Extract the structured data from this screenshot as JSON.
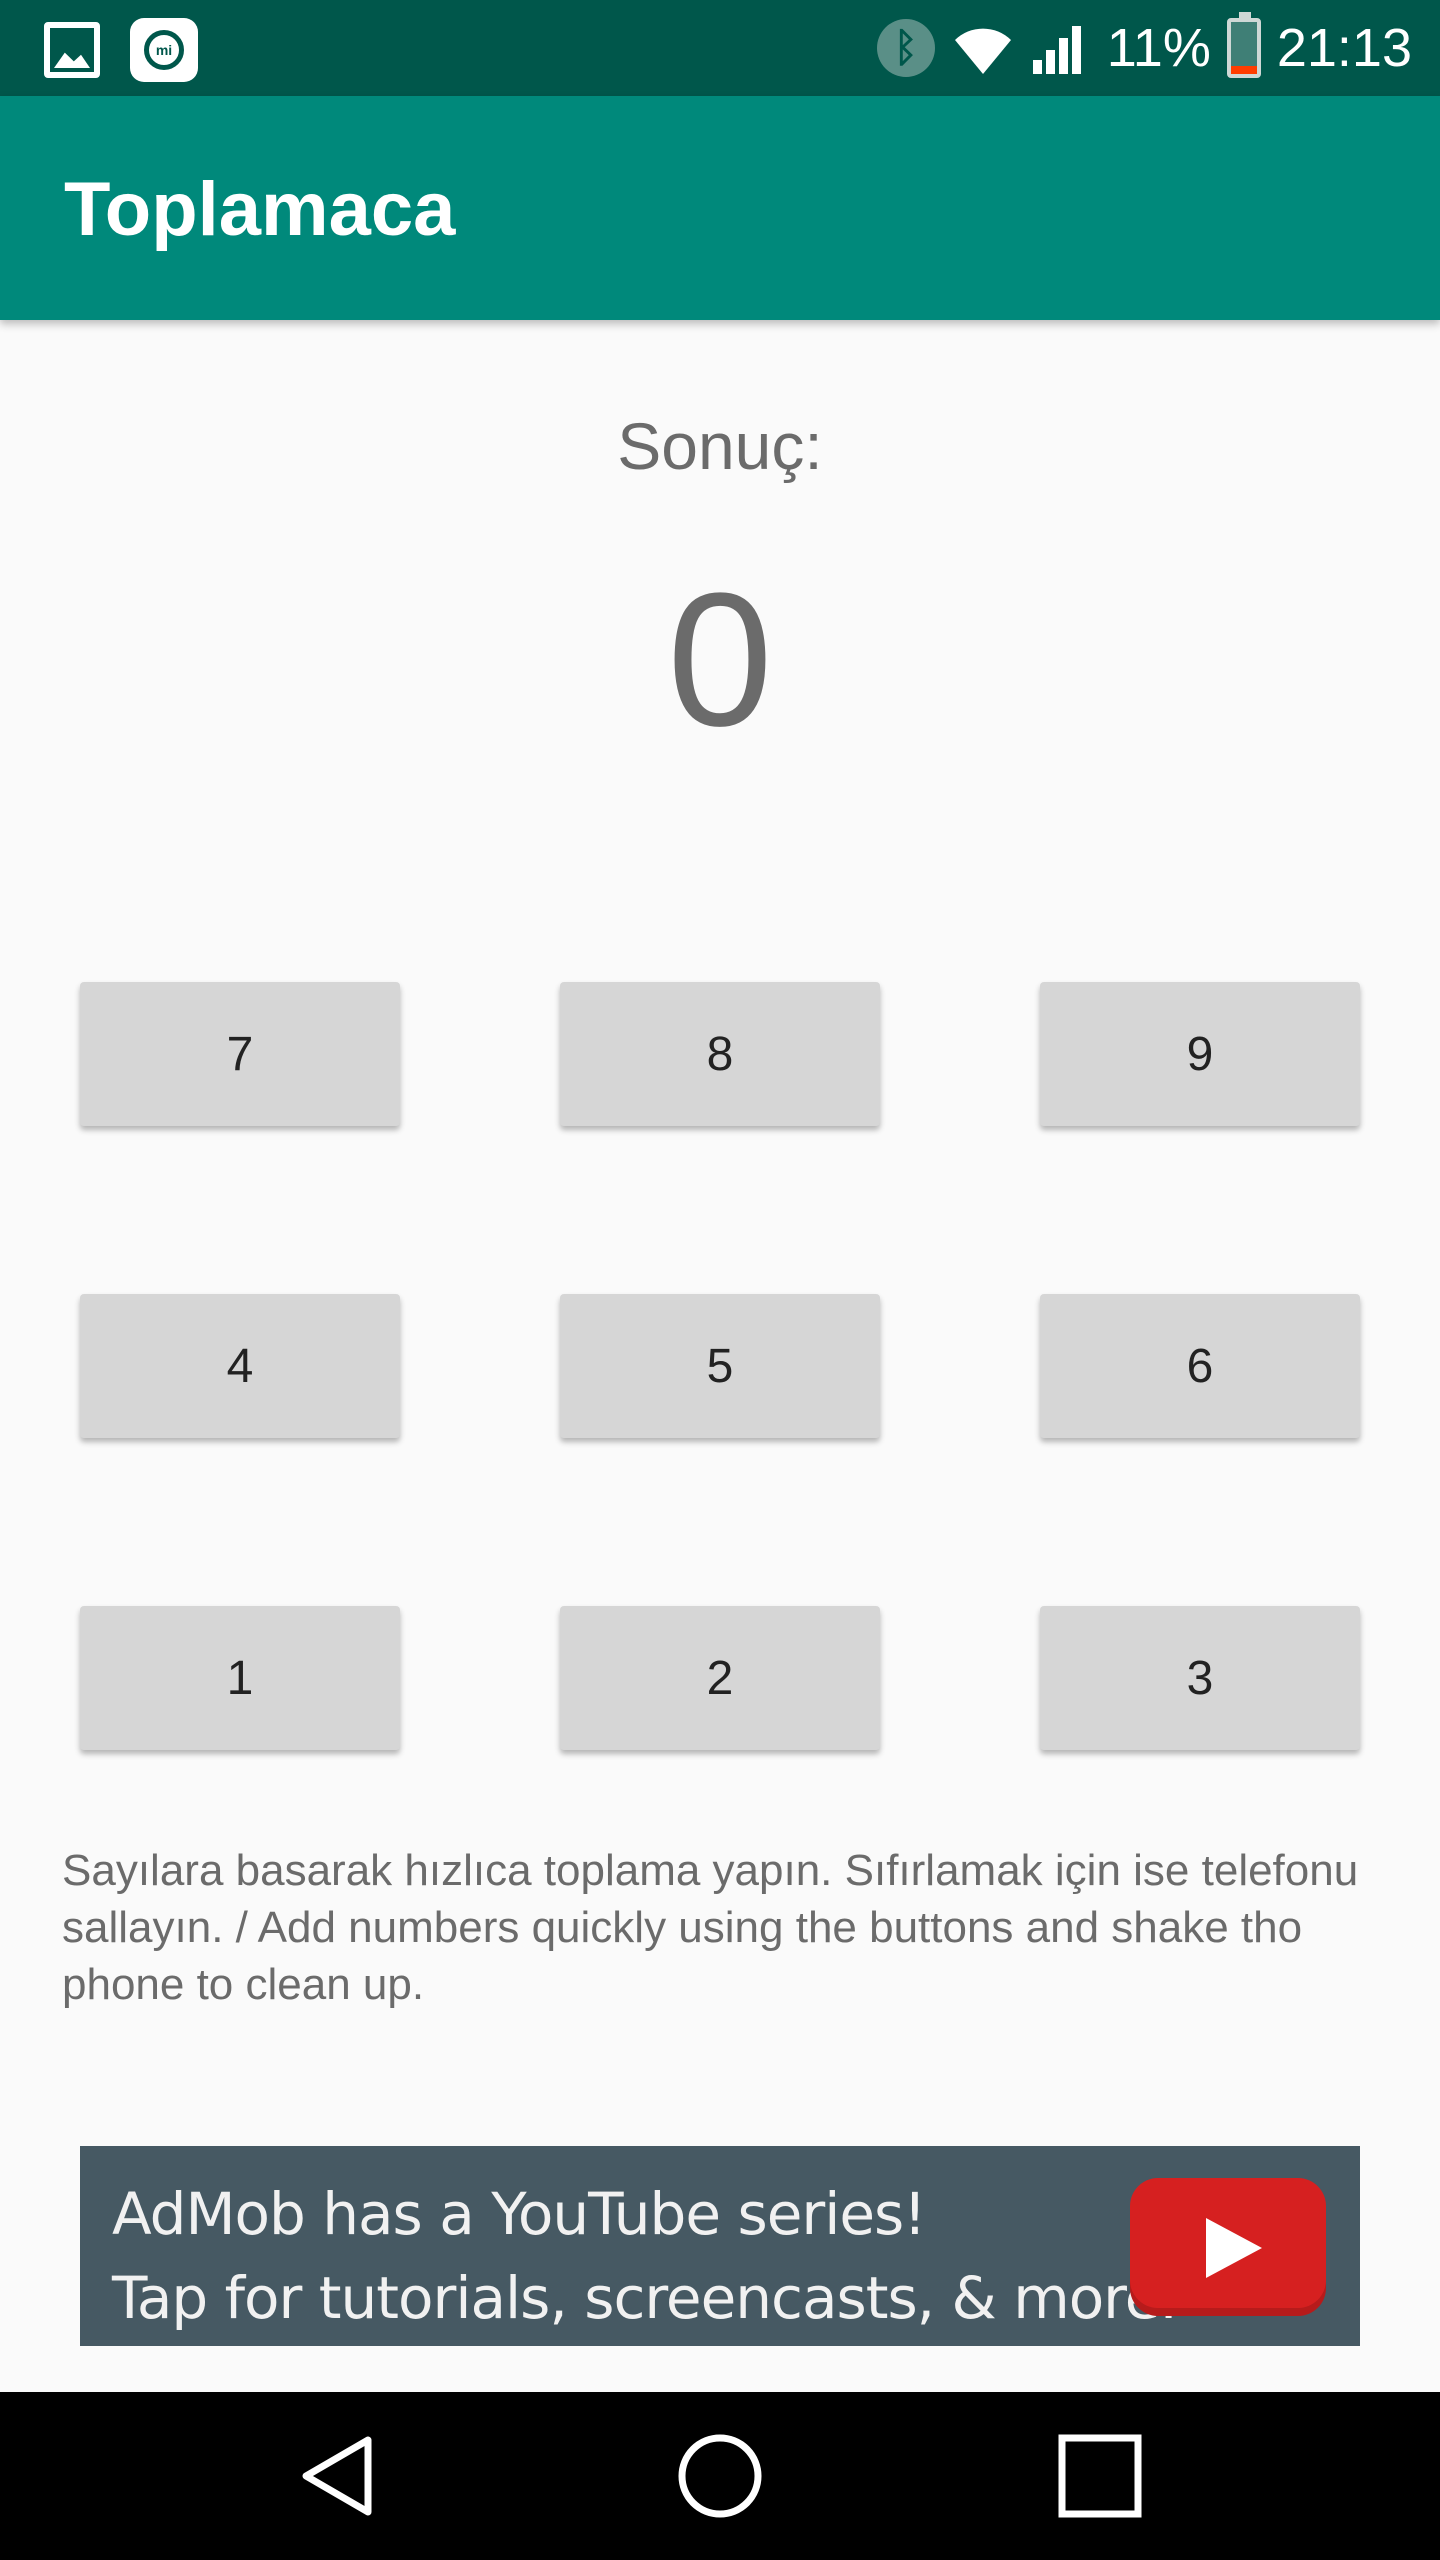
{
  "status_bar": {
    "battery": "11%",
    "time": "21:13",
    "icons": [
      "gallery-icon",
      "mi-icon",
      "bluetooth-icon",
      "wifi-icon",
      "signal-icon",
      "battery-icon"
    ]
  },
  "app_bar": {
    "title": "Toplamaca",
    "color": "#00897b"
  },
  "result": {
    "label": "Sonuç:",
    "value": "0"
  },
  "keypad": {
    "keys": [
      "7",
      "8",
      "9",
      "4",
      "5",
      "6",
      "1",
      "2",
      "3"
    ]
  },
  "instructions": "Sayılara basarak hızlıca toplama yapın. Sıfırlamak için ise telefonu sallayın. / Add numbers quickly using the buttons and shake tho phone to clean up.",
  "ad": {
    "line1": "AdMob has a YouTube series!",
    "line2": "Tap for tutorials, screencasts, & more.",
    "icon": "youtube-play-icon"
  },
  "nav_bar": {
    "icons": [
      "back-icon",
      "home-icon",
      "recents-icon"
    ]
  }
}
